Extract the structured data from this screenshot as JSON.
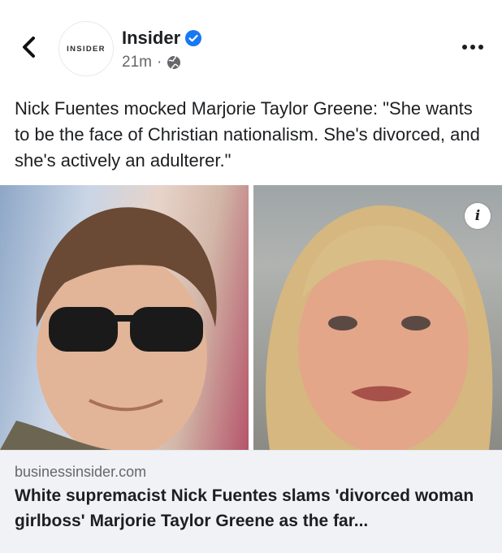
{
  "post": {
    "page_name": "Insider",
    "avatar_text": "INSIDER",
    "time": "21m",
    "separator": "·",
    "caption": "Nick Fuentes mocked Marjorie Taylor Greene: \"She wants to be the face of Christian nationalism. She's divorced, and she's actively an adulterer.\""
  },
  "icons": {
    "back": "chevron-left-icon",
    "verified": "verified-badge-icon",
    "audience": "globe-icon",
    "more": "more-horizontal-icon",
    "info": "info-icon"
  },
  "link_preview": {
    "domain": "businessinsider.com",
    "headline": "White supremacist Nick Fuentes slams 'divorced woman girlboss' Marjorie Taylor Greene as the far..."
  },
  "colors": {
    "verified_blue": "#1877f2",
    "secondary_text": "#65676b",
    "link_bg": "#f0f2f5"
  },
  "info_glyph": "i"
}
